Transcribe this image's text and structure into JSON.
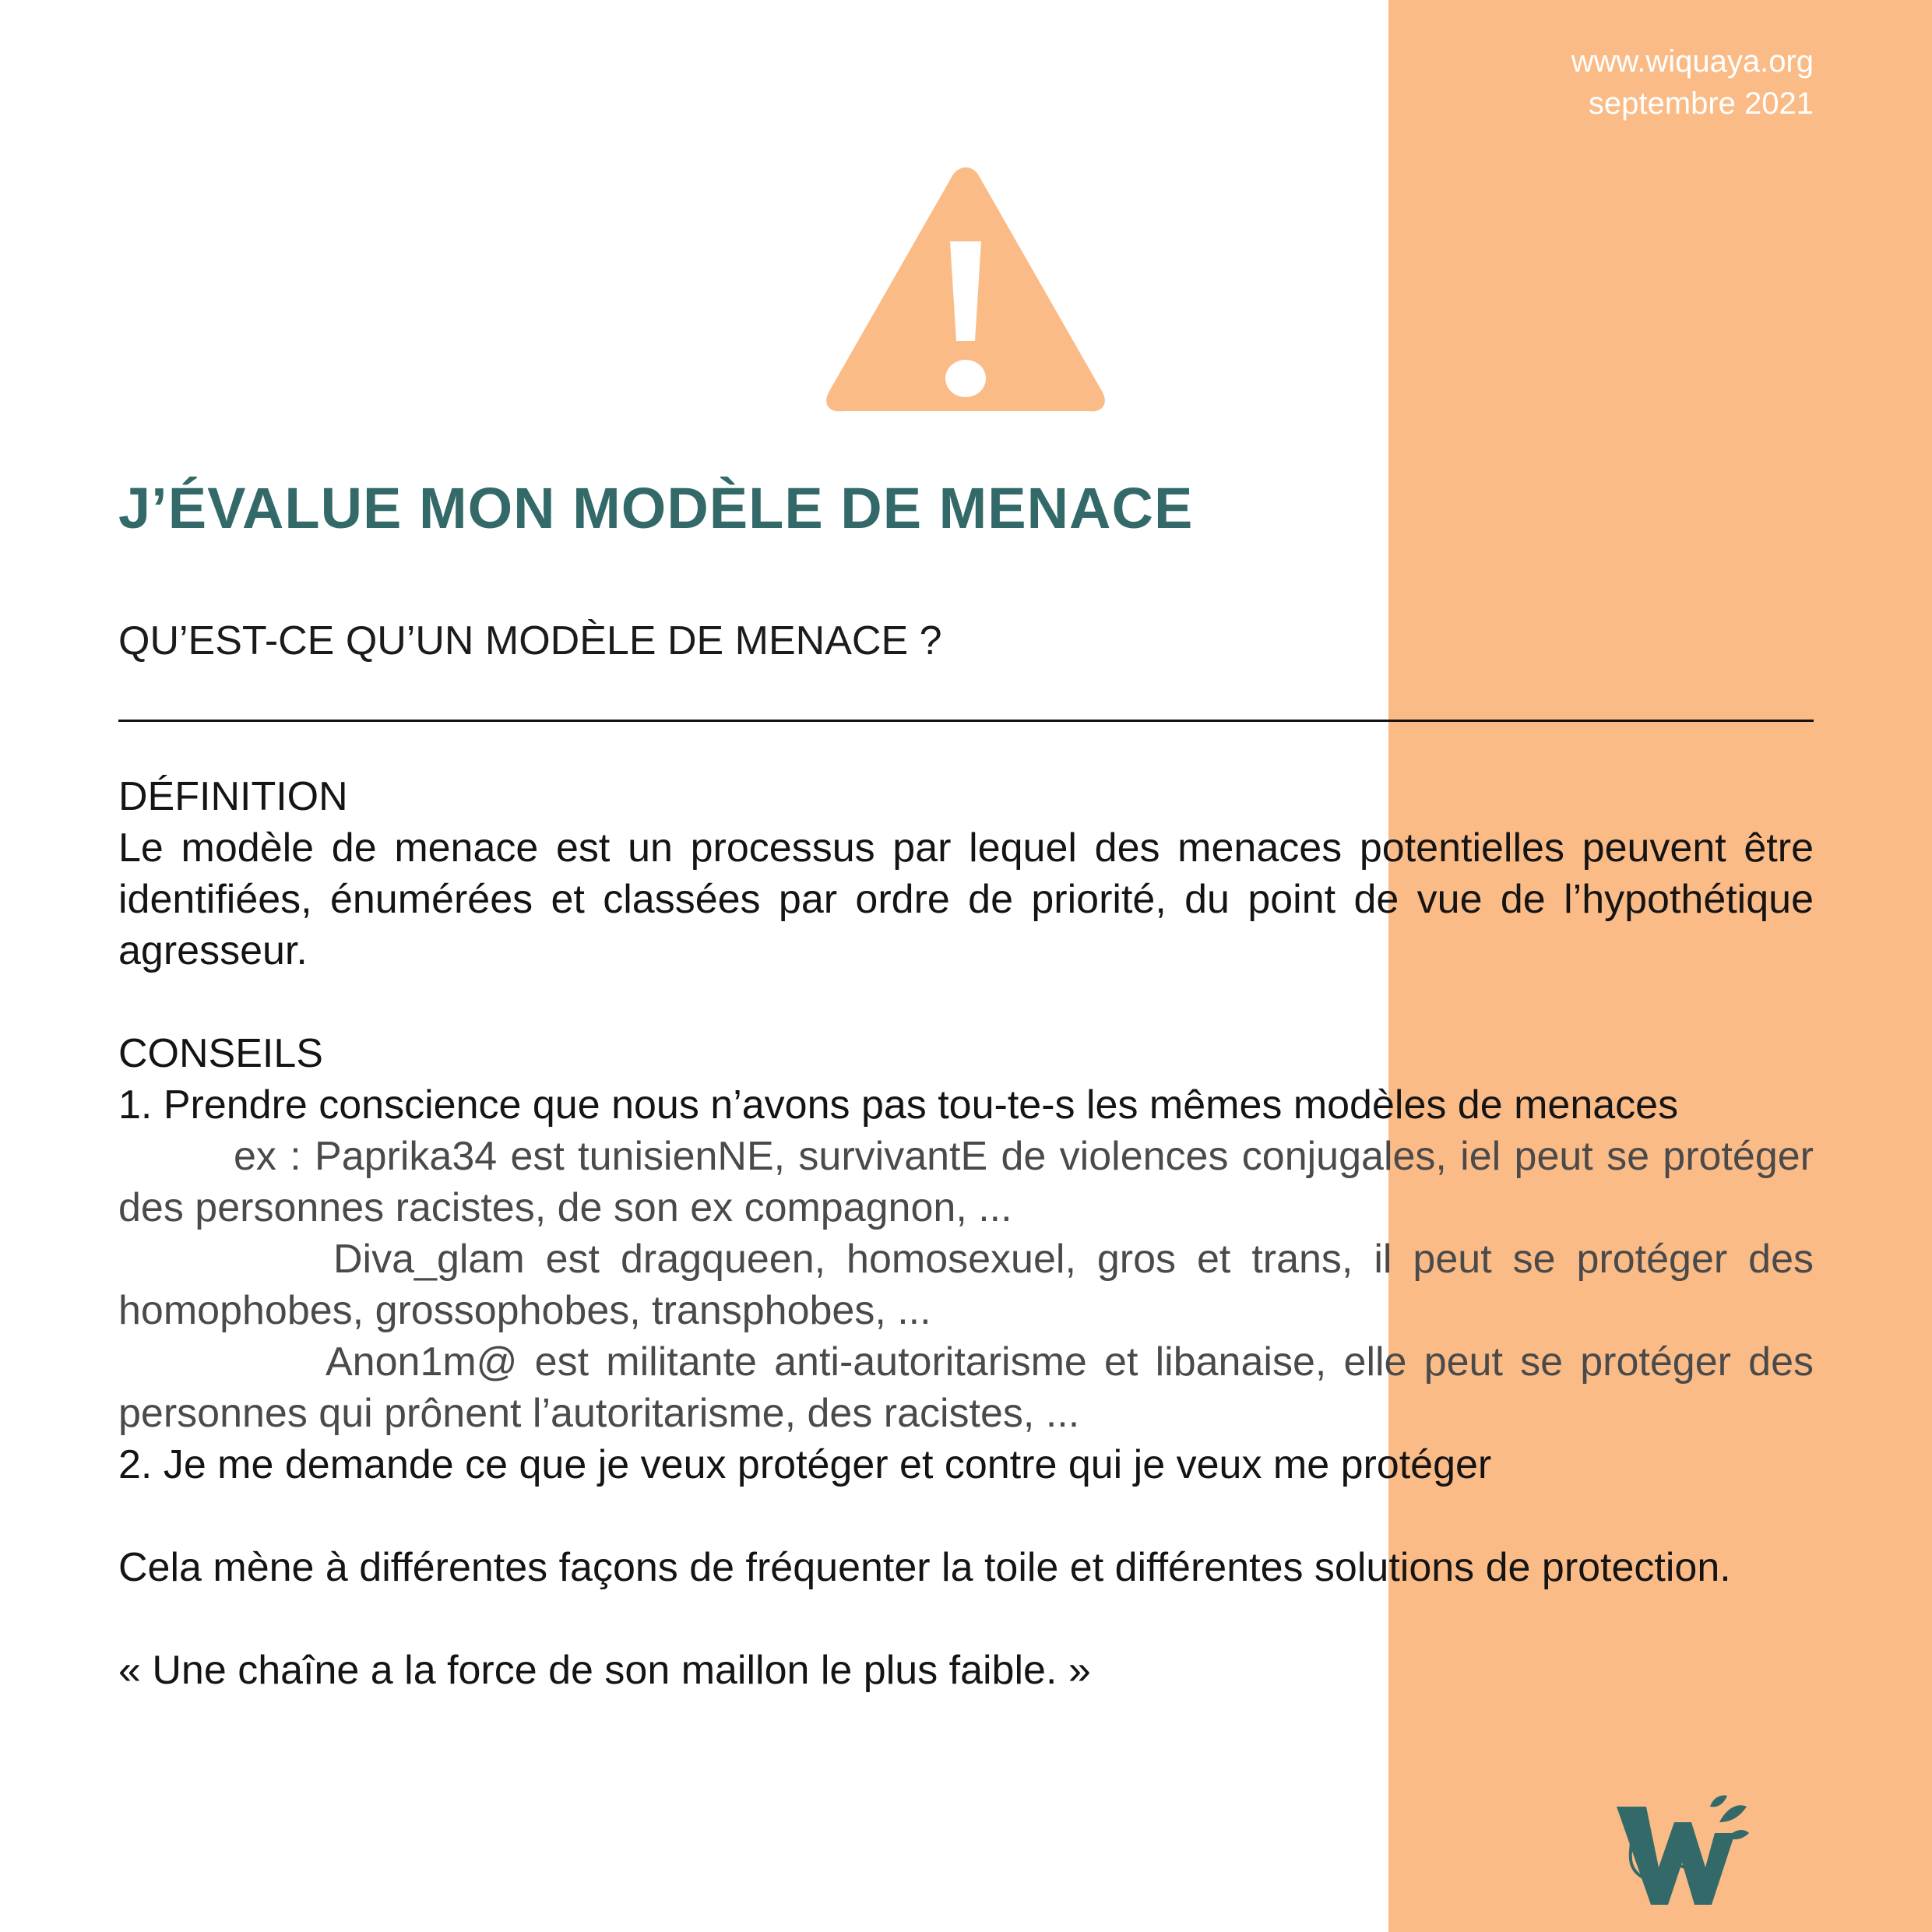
{
  "meta": {
    "website": "www.wiquaya.org",
    "date": "septembre 2021"
  },
  "icons": {
    "warning": "warning-triangle-icon",
    "logo": "wiquaya-logo"
  },
  "colors": {
    "accent_panel": "#fbbb87",
    "title": "#336a69",
    "warning_fill": "#fbbb87"
  },
  "title": "J’ÉVALUE MON MODÈLE DE MENACE",
  "question": "QU’EST-CE QU’UN MODÈLE DE MENACE ?",
  "definition": {
    "heading": "DÉFINITION",
    "text": "Le modèle de menace est un processus par lequel des menaces potentielles peuvent être identifiées, énumérées et classées par ordre de priorité, du point de vue de l’hypothétique agresseur."
  },
  "conseils": {
    "heading": "CONSEILS",
    "item1": "1. Prendre conscience que nous n’avons pas tou-te-s les mêmes modèles de menaces",
    "examples": [
      "ex : Paprika34 est tunisienNE, survivantE de violences conjugales, iel peut se protéger des personnes racistes, de son ex compagnon, ...",
      "Diva_glam est dragqueen, homosexuel, gros et trans, il peut se protéger des homophobes,  grossophobes, transphobes, ...",
      "Anon1m@ est militante anti-autoritarisme et libanaise, elle peut se protéger des personnes qui prônent l’autoritarisme, des racistes, ..."
    ],
    "item2": "2. Je me demande ce que je veux protéger et contre qui je veux me protéger"
  },
  "conclusion": "Cela mène à différentes façons de fréquenter la toile et différentes solutions de protection.",
  "quote": "« Une chaîne a la force de son maillon le plus faible. »"
}
